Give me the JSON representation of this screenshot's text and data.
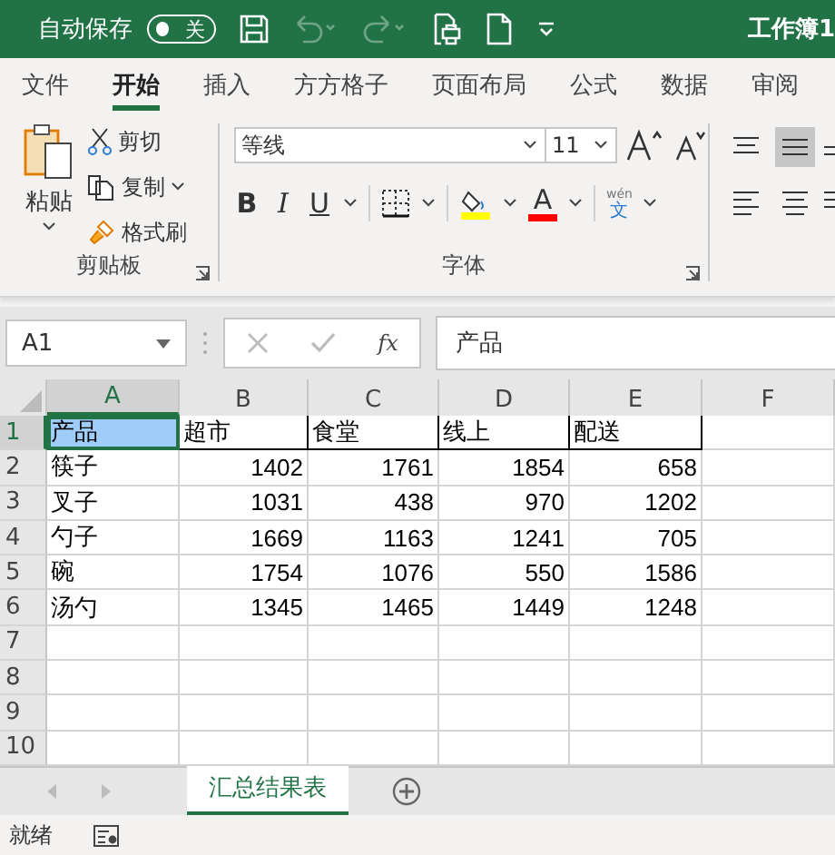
{
  "title_bar": {
    "autosave_label": "自动保存",
    "autosave_toggle": {
      "label": "关",
      "on": false
    },
    "undo_enabled": false,
    "workbook": "工作簿1"
  },
  "ribbon_tabs": [
    {
      "label": "文件",
      "selected": false
    },
    {
      "label": "开始",
      "selected": true
    },
    {
      "label": "插入",
      "selected": false
    },
    {
      "label": "方方格子",
      "selected": false
    },
    {
      "label": "页面布局",
      "selected": false
    },
    {
      "label": "公式",
      "selected": false
    },
    {
      "label": "数据",
      "selected": false
    },
    {
      "label": "审阅",
      "selected": false
    }
  ],
  "clipboard": {
    "paste": "粘贴",
    "cut": "剪切",
    "copy": "复制",
    "format_painter": "格式刷",
    "group_label": "剪贴板"
  },
  "font": {
    "font_name": "等线",
    "font_size": "11",
    "bold": "B",
    "italic": "I",
    "underline": "U",
    "font_color_glyph": "A",
    "phonetic_top": "wén",
    "phonetic_bottom": "文",
    "group_label": "字体"
  },
  "formula_bar": {
    "name_box": "A1",
    "function_label": "fx",
    "value": "产品"
  },
  "columns": [
    {
      "label": "A",
      "kind": "text",
      "selected": true
    },
    {
      "label": "B",
      "kind": "number",
      "selected": false
    },
    {
      "label": "C",
      "kind": "number",
      "selected": false
    },
    {
      "label": "D",
      "kind": "number",
      "selected": false
    },
    {
      "label": "E",
      "kind": "number",
      "selected": false
    },
    {
      "label": "F",
      "selected": false
    }
  ],
  "rows": [
    {
      "label": "1",
      "kind": "header",
      "selected": true,
      "cells": [
        "产品",
        "超市",
        "食堂",
        "线上",
        "配送"
      ]
    },
    {
      "label": "2",
      "kind": "data",
      "selected": false,
      "cells": [
        "筷子",
        "1402",
        "1761",
        "1854",
        "658"
      ]
    },
    {
      "label": "3",
      "kind": "data",
      "selected": false,
      "cells": [
        "叉子",
        "1031",
        "438",
        "970",
        "1202"
      ]
    },
    {
      "label": "4",
      "kind": "data",
      "selected": false,
      "cells": [
        "勺子",
        "1669",
        "1163",
        "1241",
        "705"
      ]
    },
    {
      "label": "5",
      "kind": "data",
      "selected": false,
      "cells": [
        "碗",
        "1754",
        "1076",
        "550",
        "1586"
      ]
    },
    {
      "label": "6",
      "kind": "data",
      "selected": false,
      "cells": [
        "汤勺",
        "1345",
        "1465",
        "1449",
        "1248"
      ]
    },
    {
      "label": "7",
      "selected": false,
      "cells": []
    },
    {
      "label": "8",
      "selected": false,
      "cells": []
    },
    {
      "label": "9",
      "selected": false,
      "cells": []
    },
    {
      "label": "10",
      "selected": false,
      "cells": []
    }
  ],
  "sheet_tabs": [
    {
      "label": "汇总结果表",
      "selected": true
    }
  ],
  "status_bar": {
    "text": "就绪"
  }
}
